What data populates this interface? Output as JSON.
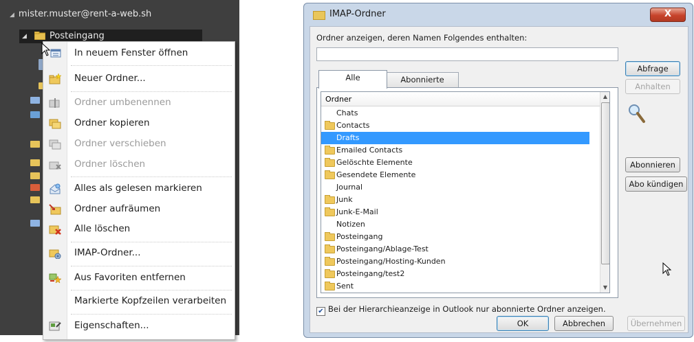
{
  "nav": {
    "account": "mister.muster@rent-a-web.sh",
    "inbox": "Posteingang"
  },
  "context_menu": {
    "items": [
      {
        "label": "In neuem Fenster öffnen",
        "enabled": true,
        "icon": "open-new-window-icon"
      },
      {
        "label": "Neuer Ordner...",
        "enabled": true,
        "icon": "new-folder-icon"
      },
      {
        "label": "Ordner umbenennen",
        "enabled": false,
        "icon": "rename-folder-icon"
      },
      {
        "label": "Ordner kopieren",
        "enabled": true,
        "icon": "copy-folder-icon"
      },
      {
        "label": "Ordner verschieben",
        "enabled": false,
        "icon": "move-folder-icon"
      },
      {
        "label": "Ordner löschen",
        "enabled": false,
        "icon": "delete-folder-icon"
      },
      {
        "label": "Alles als gelesen markieren",
        "enabled": true,
        "icon": "mark-read-icon"
      },
      {
        "label": "Ordner aufräumen",
        "enabled": true,
        "icon": "clean-up-folder-icon"
      },
      {
        "label": "Alle löschen",
        "enabled": true,
        "icon": "delete-all-icon"
      },
      {
        "label": "IMAP-Ordner...",
        "enabled": true,
        "icon": "imap-folder-icon"
      },
      {
        "label": "Aus Favoriten entfernen",
        "enabled": true,
        "icon": "remove-favorite-icon"
      },
      {
        "label": "Markierte Kopfzeilen verarbeiten",
        "enabled": true,
        "icon": ""
      },
      {
        "label": "Eigenschaften...",
        "enabled": true,
        "icon": "properties-icon"
      }
    ]
  },
  "dialog": {
    "title": "IMAP-Ordner",
    "filter_label": "Ordner anzeigen, deren Namen Folgendes enthalten:",
    "filter_value": "",
    "tabs": {
      "all": "Alle",
      "subscribed": "Abonnierte"
    },
    "list_header": "Ordner",
    "folders": [
      {
        "name": "Chats",
        "icon": false
      },
      {
        "name": "Contacts",
        "icon": true
      },
      {
        "name": "Drafts",
        "icon": false,
        "selected": true
      },
      {
        "name": "Emailed Contacts",
        "icon": true
      },
      {
        "name": "Gelöschte Elemente",
        "icon": true
      },
      {
        "name": "Gesendete Elemente",
        "icon": true
      },
      {
        "name": "Journal",
        "icon": false
      },
      {
        "name": "Junk",
        "icon": true
      },
      {
        "name": "Junk-E-Mail",
        "icon": true
      },
      {
        "name": "Notizen",
        "icon": false
      },
      {
        "name": "Posteingang",
        "icon": true
      },
      {
        "name": "Posteingang/Ablage-Test",
        "icon": true
      },
      {
        "name": "Posteingang/Hosting-Kunden",
        "icon": true
      },
      {
        "name": "Posteingang/test2",
        "icon": true
      },
      {
        "name": "Sent",
        "icon": true
      }
    ],
    "buttons": {
      "query": "Abfrage",
      "stop": "Anhalten",
      "subscribe": "Abonnieren",
      "unsubscribe": "Abo kündigen",
      "ok": "OK",
      "cancel": "Abbrechen",
      "apply": "Übernehmen"
    },
    "checkbox_label": "Bei der Hierarchieanzeige in Outlook nur abonnierte Ordner anzeigen.",
    "checkbox_checked": true,
    "close_glyph": "X"
  },
  "colors": {
    "selection": "#3399ff",
    "nav_background": "#3f3f3f",
    "dialog_frame": "#c9d7e8"
  }
}
